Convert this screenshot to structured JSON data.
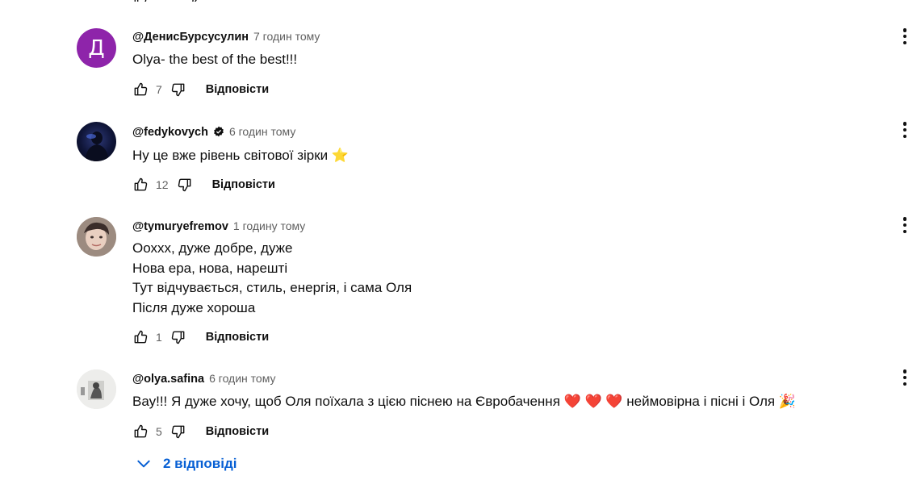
{
  "colors": {
    "text_primary": "#0f0f0f",
    "text_secondary": "#606060",
    "link_blue": "#065fd4",
    "avatar_letter_bg": "#8e24aa"
  },
  "comments": [
    {
      "author": "@ДенисБурсусулин",
      "time": "7 годин тому",
      "avatar_letter": "Д",
      "lines": [
        "Olya- the best of the best!!!"
      ],
      "likes": "7",
      "reply_label": "Відповісти"
    },
    {
      "author": "@fedykovych",
      "verified": true,
      "time": "6 годин тому",
      "lines": [
        "Ну це вже рівень світової зірки ⭐"
      ],
      "likes": "12",
      "reply_label": "Відповісти"
    },
    {
      "author": "@tymuryefremov",
      "time": "1 годину тому",
      "lines": [
        "Ооххх, дуже добре, дуже",
        "Нова ера, нова, нарешті",
        "Тут відчувається, стиль, енергія, і сама Оля",
        "Після дуже хороша"
      ],
      "likes": "1",
      "reply_label": "Відповісти"
    },
    {
      "author": "@olya.safina",
      "time": "6 годин тому",
      "lines": [
        "Вау!!! Я дуже хочу, щоб Оля поїхала з цією піснею на Євробачення ❤️ ❤️ ❤️  неймовірна і пісні і Оля 🎉"
      ],
      "likes": "5",
      "reply_label": "Відповісти"
    }
  ],
  "replies_toggle": {
    "label": "2 відповіді",
    "icon": "chevron-down-icon"
  }
}
